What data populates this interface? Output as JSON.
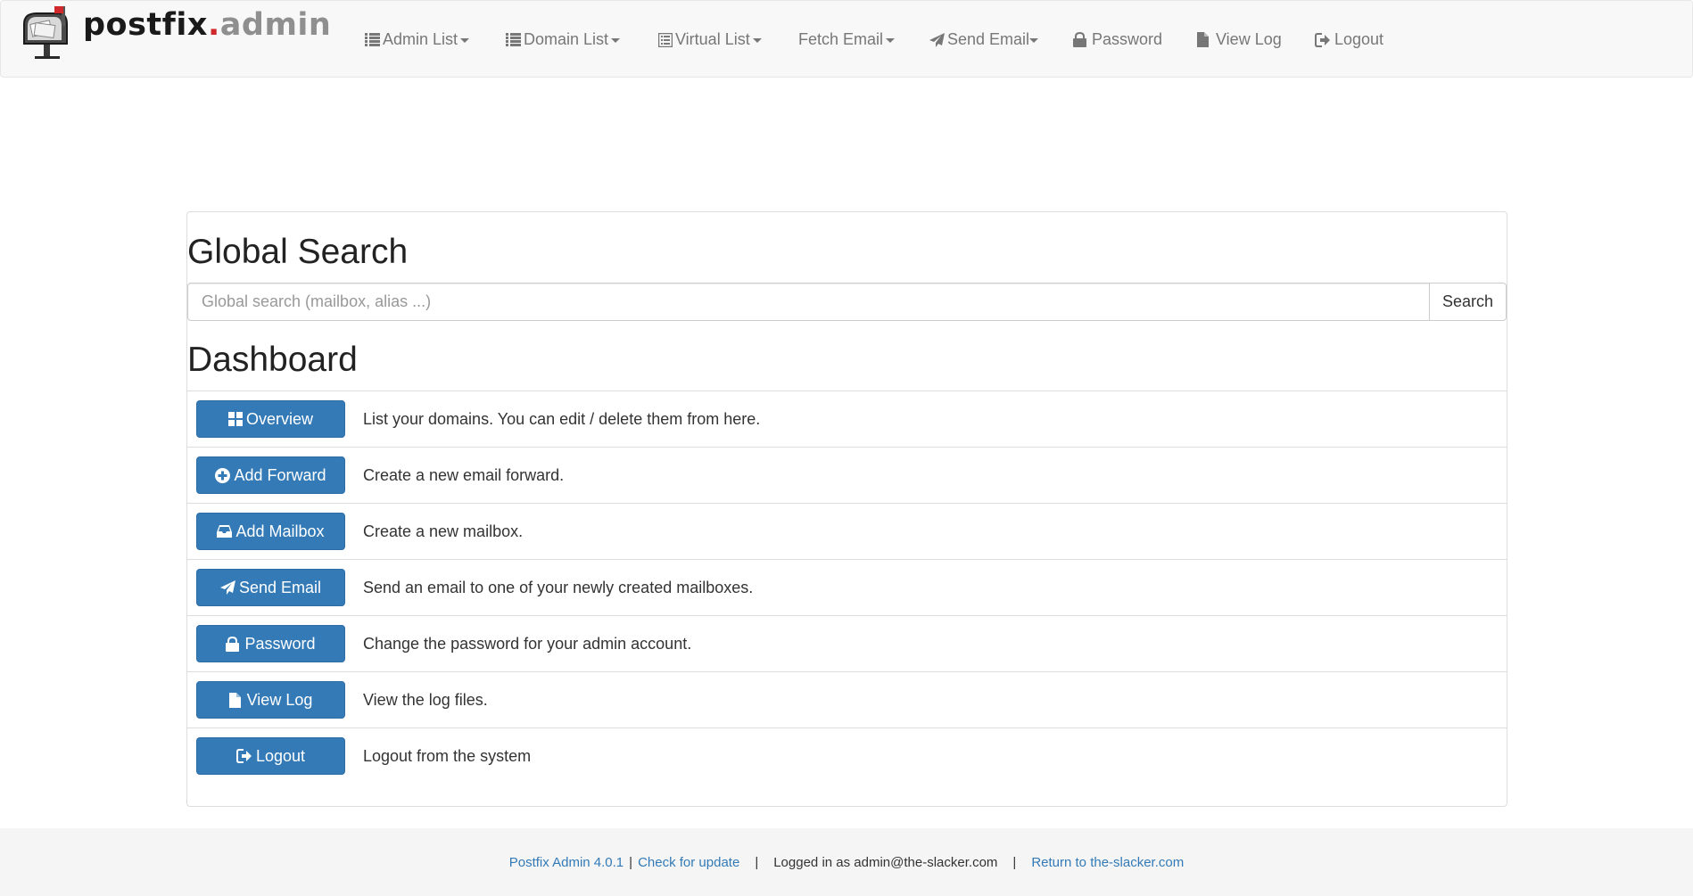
{
  "brand": {
    "name_part1": "postfix",
    "name_dot": ".",
    "name_part2": "admin",
    "logo_icon": "mailbox-icon"
  },
  "nav": {
    "admin_list": "Admin List",
    "domain_list": "Domain List",
    "virtual_list": "Virtual List",
    "fetch_email": "Fetch Email",
    "send_email": "Send Email",
    "password": "Password",
    "view_log": "View Log",
    "logout": "Logout"
  },
  "search": {
    "heading": "Global Search",
    "placeholder": "Global search (mailbox, alias ...)",
    "button_label": "Search"
  },
  "dashboard": {
    "heading": "Dashboard",
    "items": [
      {
        "label": "Overview",
        "icon": "grid-icon",
        "description": "List your domains. You can edit / delete them from here."
      },
      {
        "label": "Add Forward",
        "icon": "plus-circle-icon",
        "description": "Create a new email forward."
      },
      {
        "label": "Add Mailbox",
        "icon": "inbox-icon",
        "description": "Create a new mailbox."
      },
      {
        "label": "Send Email",
        "icon": "send-icon",
        "description": "Send an email to one of your newly created mailboxes."
      },
      {
        "label": "Password",
        "icon": "lock-icon",
        "description": "Change the password for your admin account."
      },
      {
        "label": "View Log",
        "icon": "file-icon",
        "description": "View the log files."
      },
      {
        "label": "Logout",
        "icon": "logout-icon",
        "description": "Logout from the system"
      }
    ]
  },
  "footer": {
    "version_link": "Postfix Admin 4.0.1",
    "sep1": "|",
    "update_link": "Check for update",
    "sep2": "|",
    "logged_in": "Logged in as admin@the-slacker.com",
    "sep3": "|",
    "return_link": "Return to the-slacker.com"
  },
  "colors": {
    "primary": "#337ab7",
    "navbar_bg": "#f8f8f8",
    "nav_text": "#777777",
    "brand_dot": "#d0282b",
    "footer_bg": "#f5f5f5"
  }
}
